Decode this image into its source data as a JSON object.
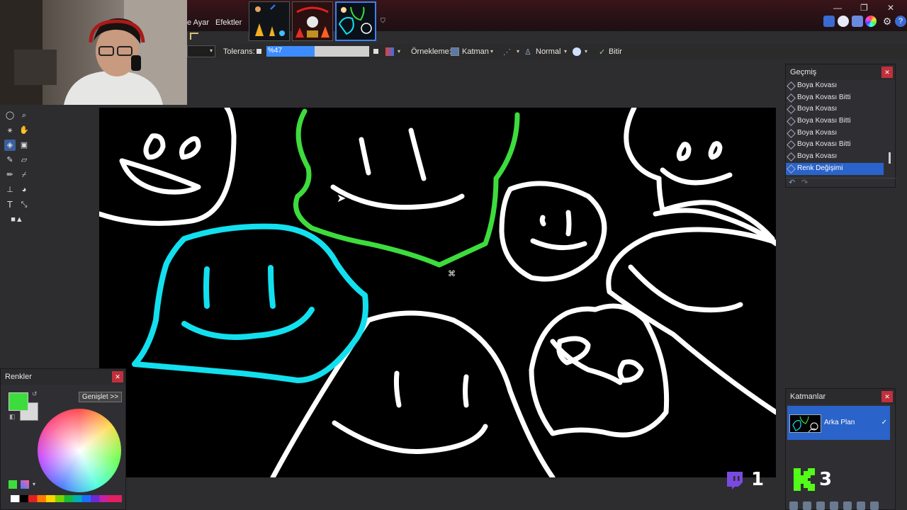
{
  "menu": {
    "adjustments_partial": "e Ayar",
    "effects": "Efektler"
  },
  "toolbar": {
    "tolerance_label": "Tolerans:",
    "tolerance_value": "%47",
    "tolerance_fraction": 0.47,
    "sampling_label": "Örnekleme:",
    "sampling_value": "Katman",
    "blend_mode": "Normal",
    "finish_label": "Bitir"
  },
  "history": {
    "title": "Geçmiş",
    "items": [
      {
        "label": "Boya Kovası",
        "active": false
      },
      {
        "label": "Boya Kovası Bitti",
        "active": false
      },
      {
        "label": "Boya Kovası",
        "active": false
      },
      {
        "label": "Boya Kovası Bitti",
        "active": false
      },
      {
        "label": "Boya Kovası",
        "active": false
      },
      {
        "label": "Boya Kovası Bitti",
        "active": false
      },
      {
        "label": "Boya Kovası",
        "active": false
      },
      {
        "label": "Renk Değişimi",
        "active": true
      }
    ]
  },
  "colors_panel": {
    "title": "Renkler",
    "expand_button": "Genişlet >>",
    "primary_color": "#3ddc3d",
    "secondary_color": "#d9d9d9"
  },
  "layers": {
    "title": "Katmanlar",
    "items": [
      {
        "name": "Arka Plan",
        "visible": true
      }
    ]
  },
  "overlay": {
    "twitch_count": "1",
    "kick_count": "3"
  },
  "colors": {
    "accent": "#2a63c9",
    "green_stroke": "#3ddc3d",
    "cyan_stroke": "#12e0ee",
    "canvas_bg": "#000000"
  }
}
